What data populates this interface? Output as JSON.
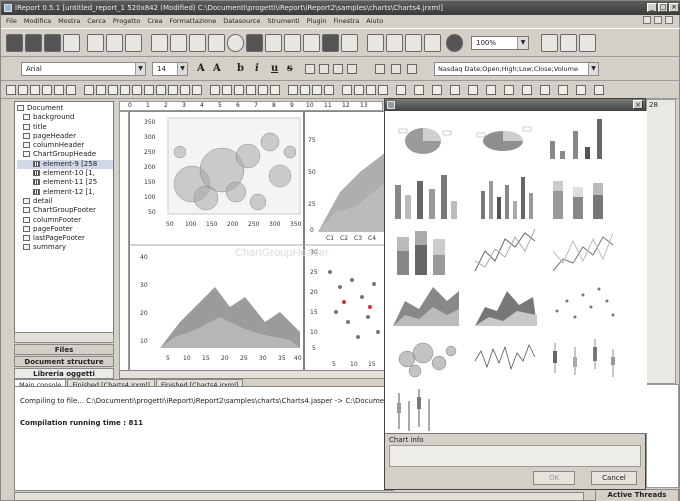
{
  "window": {
    "title": "iReport 0.5.1  [untitled_report_1 520x842 (Modified) C:\\Documenti\\progetti\\iReport\\iReport2\\samples\\charts\\Charts4.jrxml]"
  },
  "menu": [
    "File",
    "Modifica",
    "Mostra",
    "Cerca",
    "Progetto",
    "Crea",
    "Formattazione",
    "Datasource",
    "Strumenti",
    "Plugin",
    "Finestra",
    "Aiuto"
  ],
  "toolbar": {
    "zoom": "100%"
  },
  "format_toolbar": {
    "font": "Arial",
    "size": "14",
    "bold": "b",
    "italic": "i",
    "underline": "u",
    "strike": "s",
    "datasource": "Nasdaq Date;Open;High;Low;Close;Volume"
  },
  "tree": {
    "items": [
      {
        "label": "Document",
        "icon": "document-icon"
      },
      {
        "label": "background",
        "icon": "band-icon"
      },
      {
        "label": "title",
        "icon": "band-icon"
      },
      {
        "label": "pageHeader",
        "icon": "band-icon"
      },
      {
        "label": "columnHeader",
        "icon": "band-icon"
      },
      {
        "label": "ChartGroupHeade",
        "icon": "band-icon"
      },
      {
        "label": "element-9 [258",
        "icon": "chart-icon"
      },
      {
        "label": "element-10 [1,",
        "icon": "chart-icon"
      },
      {
        "label": "element-11 [25",
        "icon": "chart-icon"
      },
      {
        "label": "element-12 [1,",
        "icon": "chart-icon"
      },
      {
        "label": "detail",
        "icon": "band-icon"
      },
      {
        "label": "ChartGroupFooter",
        "icon": "band-icon"
      },
      {
        "label": "columnFooter",
        "icon": "band-icon"
      },
      {
        "label": "pageFooter",
        "icon": "band-icon"
      },
      {
        "label": "lastPageFooter",
        "icon": "band-icon"
      },
      {
        "label": "summary",
        "icon": "band-icon"
      }
    ]
  },
  "panel_tabs": [
    "Files",
    "Document structure",
    "Libreria oggetti"
  ],
  "ruler": {
    "ticks": [
      "0",
      "1",
      "2",
      "3",
      "4",
      "5",
      "6",
      "7",
      "8",
      "9",
      "10",
      "11",
      "12",
      "13"
    ],
    "right_value": "28"
  },
  "design": {
    "watermark": "ChartGroupHeader",
    "bubble_y": [
      "350",
      "300",
      "250",
      "200",
      "150",
      "100",
      "50"
    ],
    "bubble_x": [
      "50",
      "100",
      "150",
      "200",
      "250",
      "300",
      "350"
    ],
    "area_y": [
      "75",
      "50",
      "25",
      "0"
    ],
    "area_x": [
      "C1",
      "C2",
      "C3",
      "C4"
    ],
    "area2_y": [
      "40",
      "30",
      "20",
      "10"
    ],
    "area2_x": [
      "5",
      "10",
      "15",
      "20",
      "25",
      "30",
      "35",
      "40"
    ],
    "scatter_y": [
      "30",
      "25",
      "20",
      "15",
      "10",
      "5"
    ],
    "scatter_x": [
      "5",
      "10",
      "15"
    ]
  },
  "bottom": {
    "tabs": [
      "Main console",
      "Finished [Charts4.jrxml]",
      "Finished [Charts4.jrxml]"
    ],
    "line1": "Compiling to file... C:\\Documenti\\progetti\\iReport\\iReport2\\samples\\charts\\Charts4.jasper -> C:\\Documen",
    "line2": "Compilation running time : 811"
  },
  "active_threads": "Active Threads",
  "dialog": {
    "chart_info_label": "Chart info",
    "ok": "OK",
    "cancel": "Cancel"
  },
  "colors": {
    "window_bg": "#d4d0c8",
    "title_bg": "#3a3a3a",
    "bubble": "#9a9a9a"
  }
}
